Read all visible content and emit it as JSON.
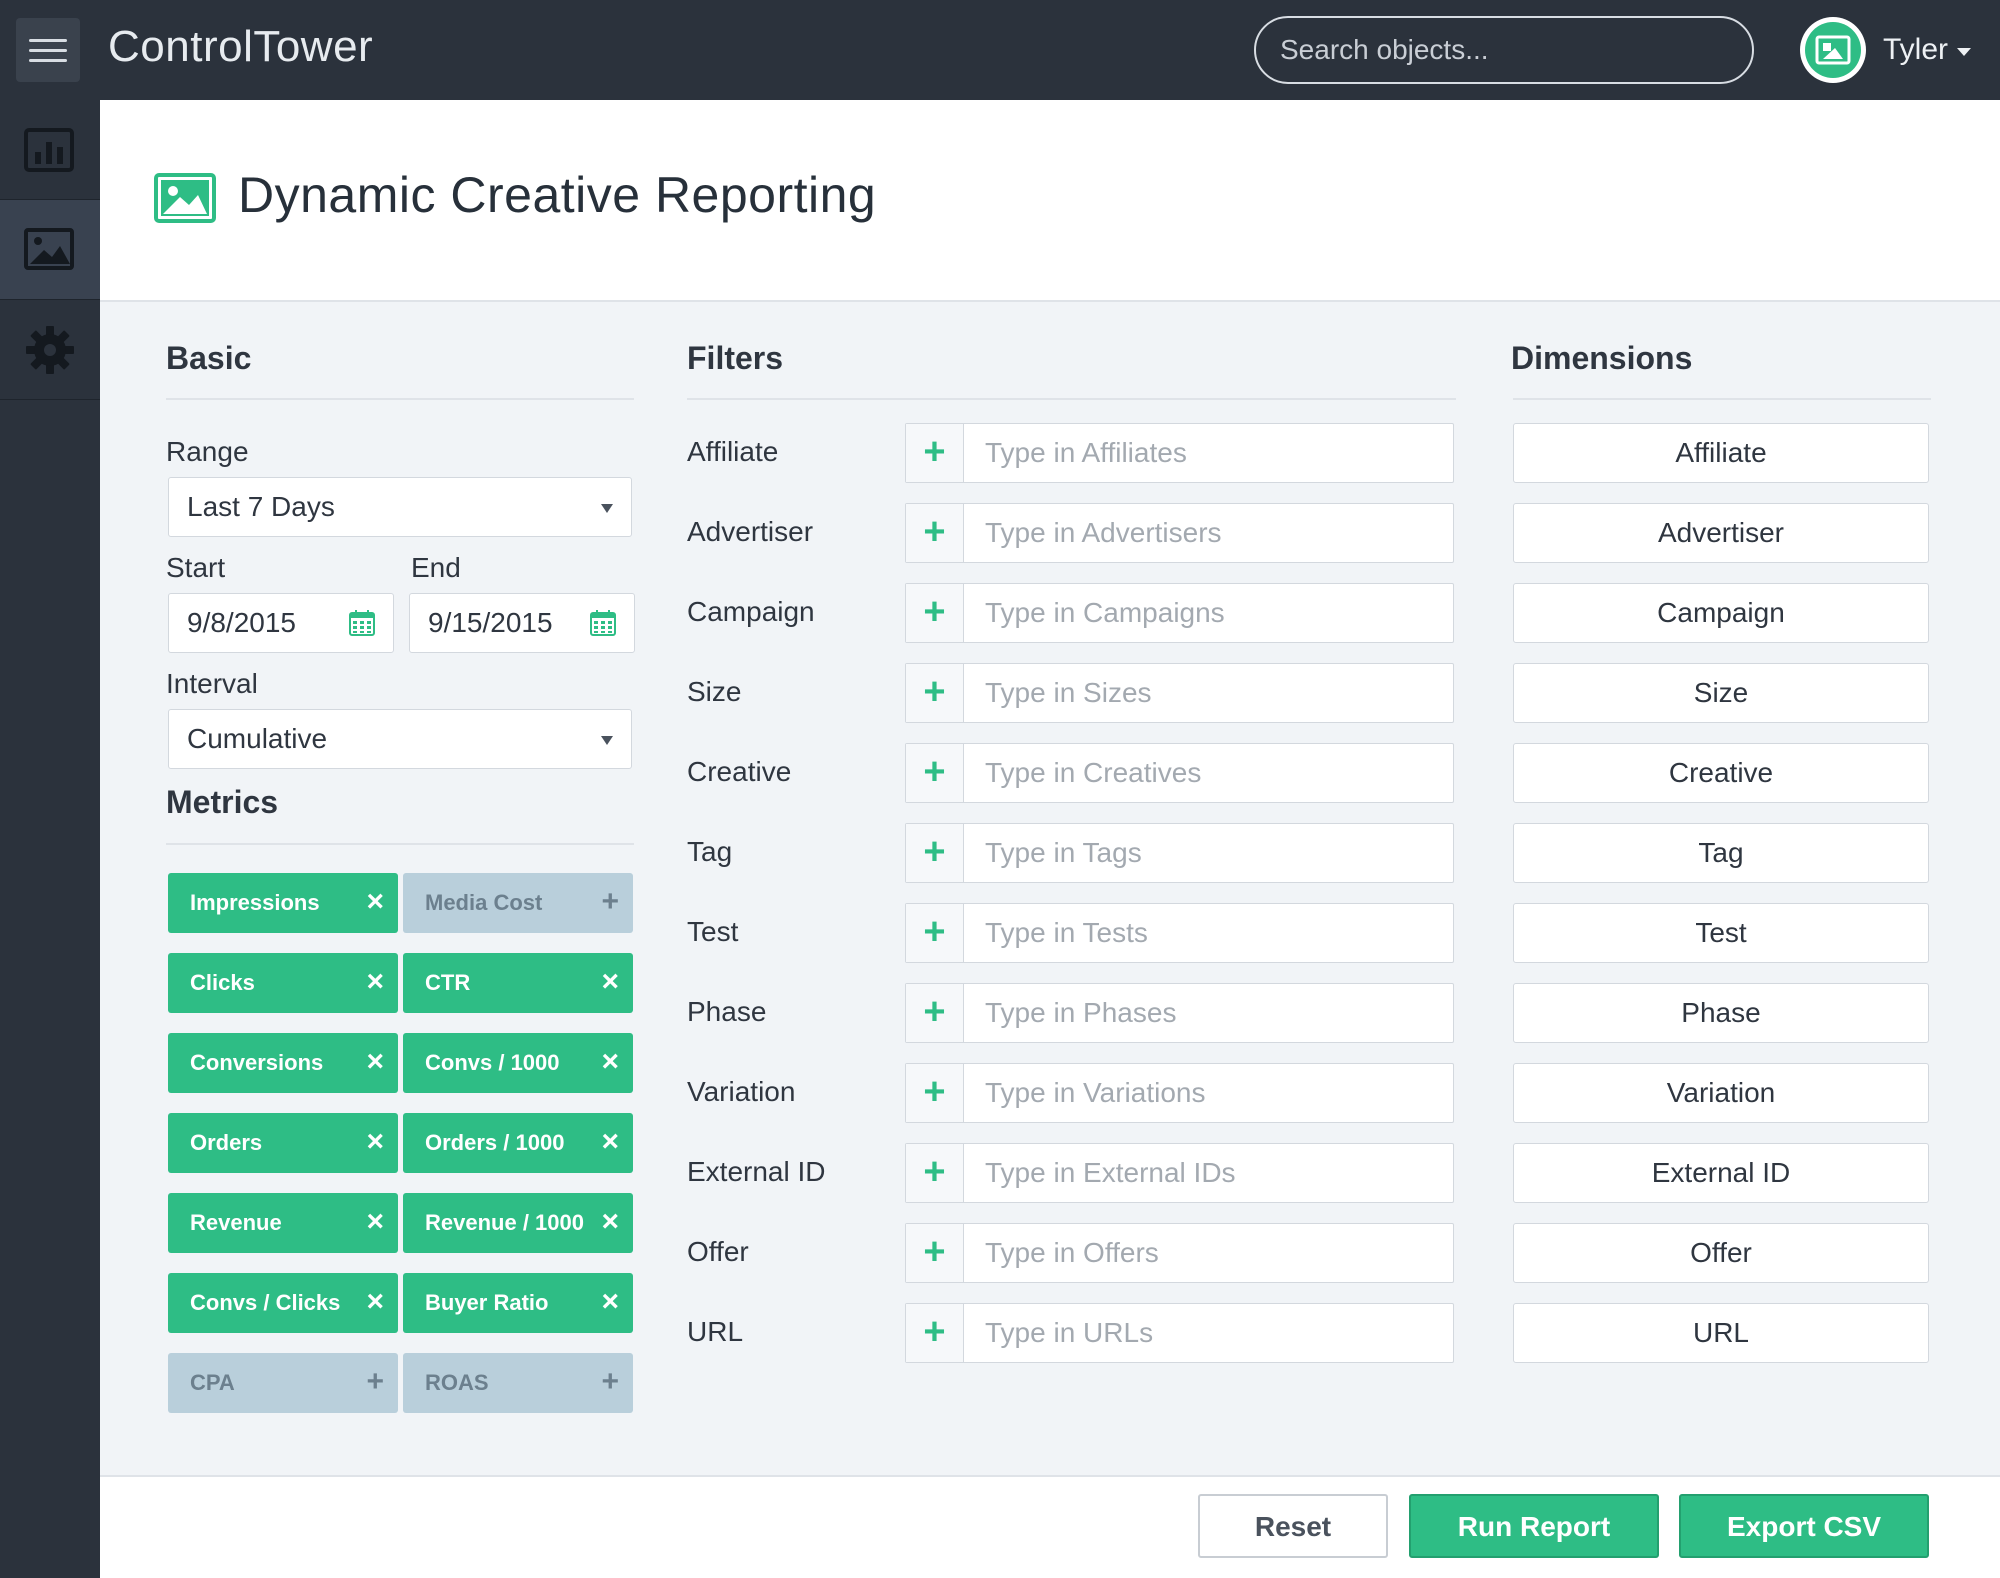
{
  "app": {
    "title": "ControlTower"
  },
  "search": {
    "placeholder": "Search objects..."
  },
  "user": {
    "name": "Tyler"
  },
  "sidebar": {
    "items": [
      {
        "name": "reports",
        "icon": "bar-chart-icon"
      },
      {
        "name": "creatives",
        "icon": "image-icon"
      },
      {
        "name": "settings",
        "icon": "gear-icon"
      }
    ]
  },
  "page": {
    "title": "Dynamic Creative Reporting"
  },
  "basic": {
    "title": "Basic",
    "range_label": "Range",
    "range_value": "Last 7 Days",
    "start_label": "Start",
    "start_value": "9/8/2015",
    "end_label": "End",
    "end_value": "9/15/2015",
    "interval_label": "Interval",
    "interval_value": "Cumulative"
  },
  "metrics": {
    "title": "Metrics",
    "items": [
      {
        "label": "Impressions",
        "active": true
      },
      {
        "label": "Media Cost",
        "active": false
      },
      {
        "label": "Clicks",
        "active": true
      },
      {
        "label": "CTR",
        "active": true
      },
      {
        "label": "Conversions",
        "active": true
      },
      {
        "label": "Convs / 1000",
        "active": true
      },
      {
        "label": "Orders",
        "active": true
      },
      {
        "label": "Orders / 1000",
        "active": true
      },
      {
        "label": "Revenue",
        "active": true
      },
      {
        "label": "Revenue / 1000",
        "active": true
      },
      {
        "label": "Convs / Clicks",
        "active": true
      },
      {
        "label": "Buyer Ratio",
        "active": true
      },
      {
        "label": "CPA",
        "active": false
      },
      {
        "label": "ROAS",
        "active": false
      }
    ],
    "remove_glyph": "×",
    "add_glyph": "+"
  },
  "filters": {
    "title": "Filters",
    "add_glyph": "+",
    "items": [
      {
        "label": "Affiliate",
        "placeholder": "Type in Affiliates"
      },
      {
        "label": "Advertiser",
        "placeholder": "Type in Advertisers"
      },
      {
        "label": "Campaign",
        "placeholder": "Type in Campaigns"
      },
      {
        "label": "Size",
        "placeholder": "Type in Sizes"
      },
      {
        "label": "Creative",
        "placeholder": "Type in Creatives"
      },
      {
        "label": "Tag",
        "placeholder": "Type in Tags"
      },
      {
        "label": "Test",
        "placeholder": "Type in Tests"
      },
      {
        "label": "Phase",
        "placeholder": "Type in Phases"
      },
      {
        "label": "Variation",
        "placeholder": "Type in Variations"
      },
      {
        "label": "External ID",
        "placeholder": "Type in External IDs"
      },
      {
        "label": "Offer",
        "placeholder": "Type in Offers"
      },
      {
        "label": "URL",
        "placeholder": "Type in URLs"
      }
    ]
  },
  "dimensions": {
    "title": "Dimensions",
    "items": [
      "Affiliate",
      "Advertiser",
      "Campaign",
      "Size",
      "Creative",
      "Tag",
      "Test",
      "Phase",
      "Variation",
      "External ID",
      "Offer",
      "URL"
    ]
  },
  "actions": {
    "reset": "Reset",
    "run": "Run Report",
    "export": "Export CSV"
  },
  "colors": {
    "accent": "#2ebd85",
    "topbar": "#2b323c",
    "inactive_chip": "#b9cfdb"
  }
}
